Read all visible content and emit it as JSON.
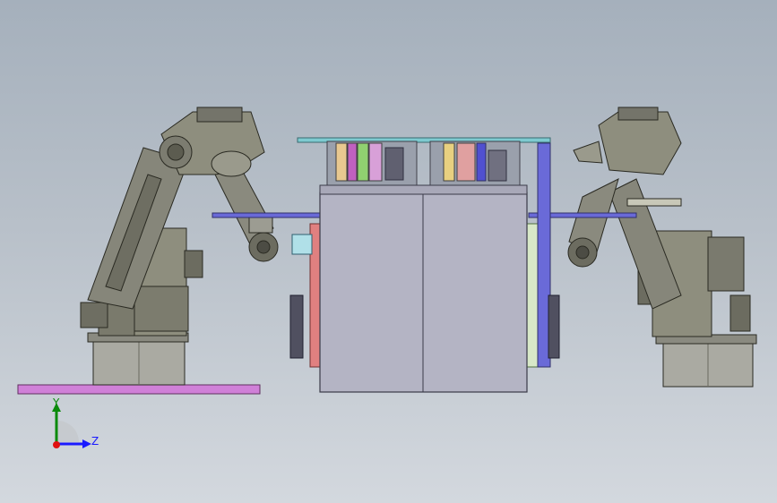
{
  "viewport": {
    "background_top": "#a5b0bc",
    "background_bottom": "#d3d8de"
  },
  "triad": {
    "y_label": "Y",
    "z_label": "Z",
    "y_color": "#0a8a0a",
    "z_color": "#1a1aff",
    "x_color": "#e01010"
  },
  "colors": {
    "robot_body": "#8e8e7e",
    "robot_dark": "#5c5c50",
    "robot_base": "#aaaaa2",
    "floor_plate": "#d080d8",
    "cabinet": "#b4b4c4",
    "blue_frame": "#5a5ad0",
    "cyan_rail": "#7ecad0",
    "red_panel": "#e08080"
  },
  "scene_parts": [
    "left-robot-arm",
    "right-robot-arm",
    "center-machine-cabinet",
    "floor-plate",
    "coordinate-triad"
  ]
}
